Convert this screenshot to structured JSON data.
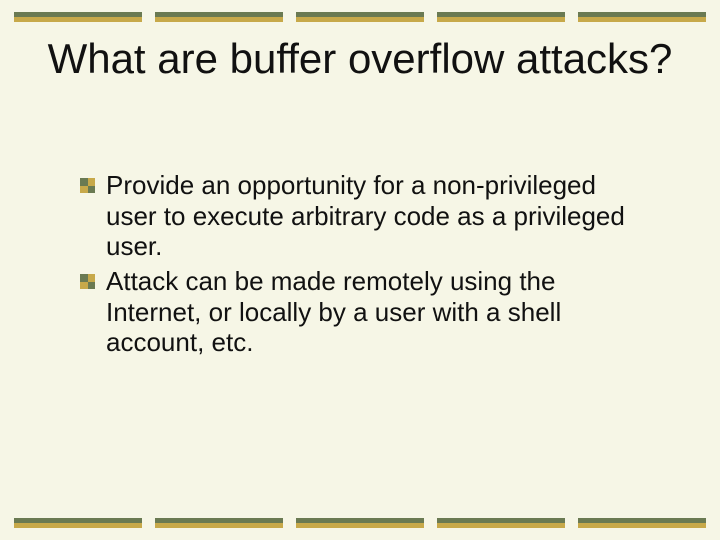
{
  "title": "What are buffer overflow attacks?",
  "bullets": [
    "Provide an opportunity for a non-privileged user to execute arbitrary code as a privileged user.",
    "Attack can be made remotely using the Internet, or locally by a user with a shell account, etc."
  ]
}
